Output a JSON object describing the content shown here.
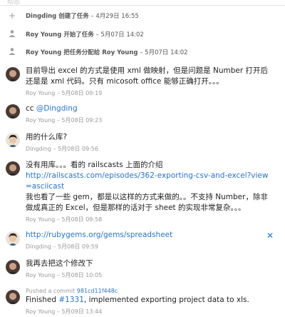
{
  "header": {
    "label": "动态"
  },
  "events": [
    {
      "icon": "plus-icon",
      "text": "Dingding 创建了任务",
      "time": "– 4月29日 16:55"
    },
    {
      "icon": "person-icon",
      "text": "Roy Young 开始了任务",
      "time": "– 5月07日 14:02"
    },
    {
      "icon": "person-icon",
      "text": "Roy Young 把任务分配给 Roy Young",
      "time": "– 5月07日 14:02"
    }
  ],
  "comments": [
    {
      "avatar": "roy",
      "lines": [
        "目前导出 excel 的方式是使用 xml 做映射，但是问题是 Number 打开后还是是 xml 代码。只有 micosoft office 能够正确打开。。。"
      ],
      "meta": "Roy Young – 5月08日 09:19"
    },
    {
      "avatar": "roy",
      "prefix": "cc ",
      "mention": "@Dingding",
      "meta": "Roy Young – 5月08日 09:23"
    },
    {
      "avatar": "dingding",
      "text": "用的什么库?",
      "meta": "Dingding – 5月08日 09:56"
    },
    {
      "avatar": "roy",
      "text1": "没有用库。。。看的 railscasts 上面的介绍",
      "link": "http://railscasts.com/episodes/362-exporting-csv-and-excel?view=asciicast",
      "text2": "我也看了一些 gem，都是以这样的方式来做的。。不支持 Number，除非做成真正的 Excel，但是那样的话对于 sheet 的实现非常复杂。。。",
      "meta": "Roy Young – 5月08日 09:58"
    },
    {
      "avatar": "dingding",
      "link": "http://rubygems.org/gems/spreadsheet",
      "meta": "Dingding – 5月08日 09:59",
      "close": "✕"
    },
    {
      "avatar": "roy",
      "text": "我再去把这个修改下",
      "meta": "Roy Young – 5月08日 10:05"
    },
    {
      "avatar": "roy",
      "sub_prefix": "Pushed a commit ",
      "sub_link": "981cd11f448c",
      "text_prefix": "Finished ",
      "issue": "#1331",
      "text_suffix": ", implemented exporting project data to xls.",
      "meta": "Roy Young – 5月09日 13:44"
    }
  ],
  "colors": {
    "link": "#2a74c6",
    "meta": "#999999",
    "text": "#222222"
  }
}
